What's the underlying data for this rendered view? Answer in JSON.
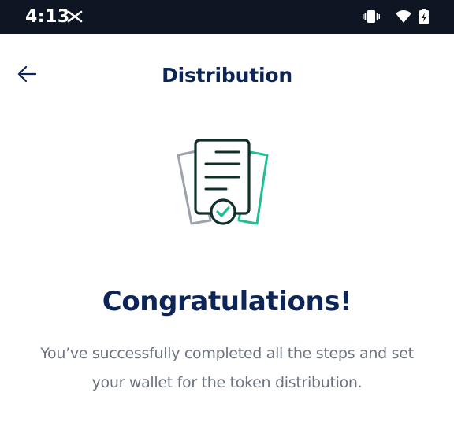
{
  "status_bar": {
    "time": "4:13",
    "left_icon": "x-logo-icon",
    "right_icons": [
      "vibrate-icon",
      "wifi-icon",
      "battery-icon"
    ]
  },
  "header": {
    "back_icon": "arrow-left-icon",
    "title": "Distribution"
  },
  "illustration": {
    "icon": "certified-document-icon",
    "colors": {
      "primary": "#0f2f2a",
      "accent": "#1fbf94",
      "secondary": "#9ca3af"
    }
  },
  "main": {
    "heading": "Congratulations!",
    "message": "You’ve successfully completed all the steps and set your wallet for the token distribution."
  },
  "colors": {
    "status_bar_bg": "#0f1623",
    "title": "#0c2456",
    "body_text": "#6b7280"
  }
}
